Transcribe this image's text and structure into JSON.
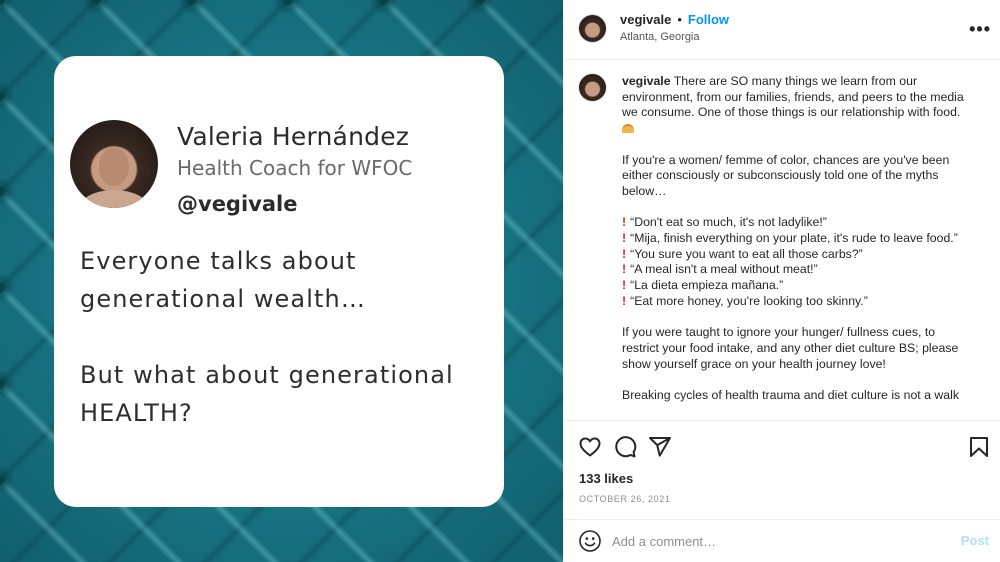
{
  "card": {
    "name": "Valeria Hernández",
    "role": "Health Coach for WFOC",
    "handle": "@vegivale",
    "text_line1": "Everyone talks about generational wealth…",
    "text_line2": "But what about generational HEALTH?"
  },
  "header": {
    "username": "vegivale",
    "separator": "•",
    "follow_label": "Follow",
    "location": "Atlanta, Georgia",
    "more_icon": "more-options-icon"
  },
  "caption": {
    "username": "vegivale",
    "intro": "There are SO many things we learn from our environment, from our families, friends, and peers to the media we consume. One of those things is our relationship with food.",
    "separator": "⠀⠀⠀⠀⠀⠀⠀⠀⠀",
    "para2": "If you're a women/ femme of color, chances are you've been either consciously or subconsciously told one of the myths below…",
    "myths": [
      "“Don't eat so much, it's not ladylike!”",
      "“Mija, finish everything on your plate, it's rude to leave food.”",
      "“You sure you want to eat all those carbs?”",
      "“A meal isn't a meal without meat!”",
      "“La dieta empieza mañana.”",
      "“Eat more honey, you're looking too skinny.”"
    ],
    "para3": "If you were taught to ignore your hunger/ fullness cues, to restrict your food intake, and any other diet culture BS; please show yourself grace on your health journey love!",
    "para4": "Breaking cycles of health trauma and diet culture is not a walk"
  },
  "actions": {
    "icons": [
      "heart-icon",
      "comment-icon",
      "share-icon",
      "bookmark-icon"
    ],
    "likes": "133 likes",
    "date": "OCTOBER 26, 2021"
  },
  "comment": {
    "placeholder": "Add a comment…",
    "post_label": "Post"
  },
  "colors": {
    "accent": "#0095f6",
    "post_disabled": "#b2dffc",
    "teal_background": "#1b7f8f",
    "myth_marker": "#e0262f"
  }
}
